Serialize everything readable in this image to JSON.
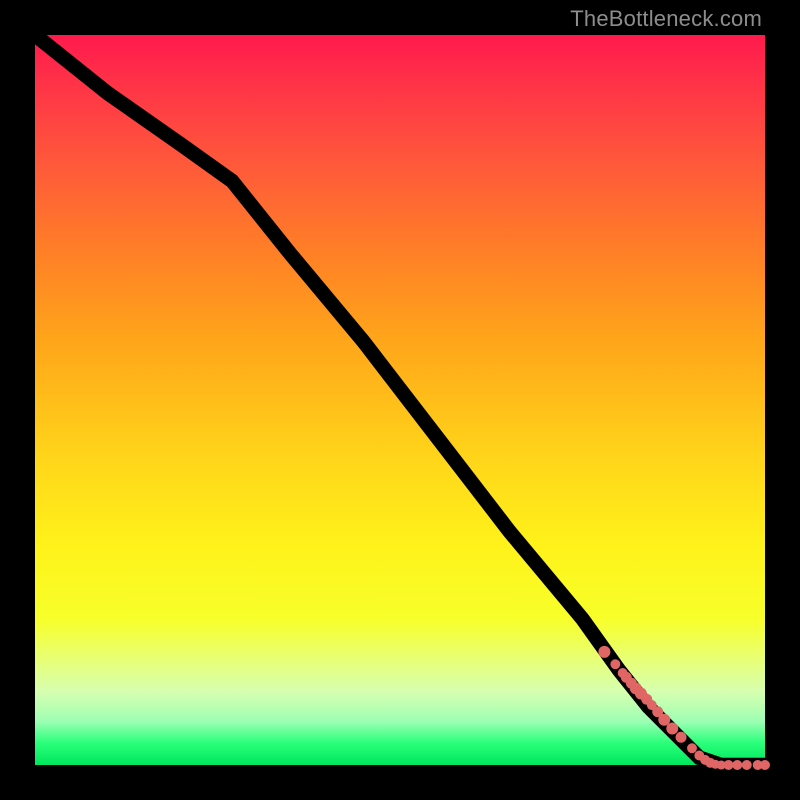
{
  "watermark": "TheBottleneck.com",
  "chart_data": {
    "type": "line",
    "title": "",
    "xlabel": "",
    "ylabel": "",
    "xlim": [
      0,
      100
    ],
    "ylim": [
      0,
      100
    ],
    "grid": false,
    "legend": false,
    "series": [
      {
        "name": "curve",
        "x": [
          0,
          10,
          20,
          27,
          35,
          45,
          55,
          65,
          75,
          80,
          84,
          88,
          91,
          94,
          100
        ],
        "y": [
          100,
          92,
          85,
          80,
          70,
          58,
          45,
          32,
          20,
          13,
          8,
          4,
          1,
          0,
          0
        ]
      }
    ],
    "markers": {
      "name": "bottleneck-region",
      "x": [
        78,
        79.5,
        80.5,
        81,
        81.7,
        82.3,
        83,
        83.8,
        84.5,
        85.3,
        86.2,
        87.3,
        88.5,
        90,
        91,
        91.8,
        92.5,
        93.2,
        94,
        95,
        96.2,
        97.5,
        99,
        100
      ],
      "y": [
        15.5,
        13.8,
        12.6,
        12,
        11.2,
        10.5,
        9.8,
        9,
        8.2,
        7.3,
        6.2,
        5,
        3.8,
        2.3,
        1.3,
        0.7,
        0.3,
        0.1,
        0,
        0,
        0,
        0,
        0,
        0
      ],
      "r": [
        6,
        5,
        5,
        5.5,
        5.5,
        6,
        6,
        5.5,
        5,
        5.5,
        6,
        6,
        5.5,
        5,
        5,
        5,
        5,
        4.5,
        4.5,
        5,
        5,
        5,
        5,
        5
      ]
    },
    "background_gradient": {
      "stops": [
        {
          "pos": 0.0,
          "color": "#ff1a4d"
        },
        {
          "pos": 0.3,
          "color": "#ff8026"
        },
        {
          "pos": 0.58,
          "color": "#ffd51a"
        },
        {
          "pos": 0.8,
          "color": "#f7ff2a"
        },
        {
          "pos": 0.94,
          "color": "#9dffb4"
        },
        {
          "pos": 1.0,
          "color": "#00e65c"
        }
      ]
    }
  }
}
